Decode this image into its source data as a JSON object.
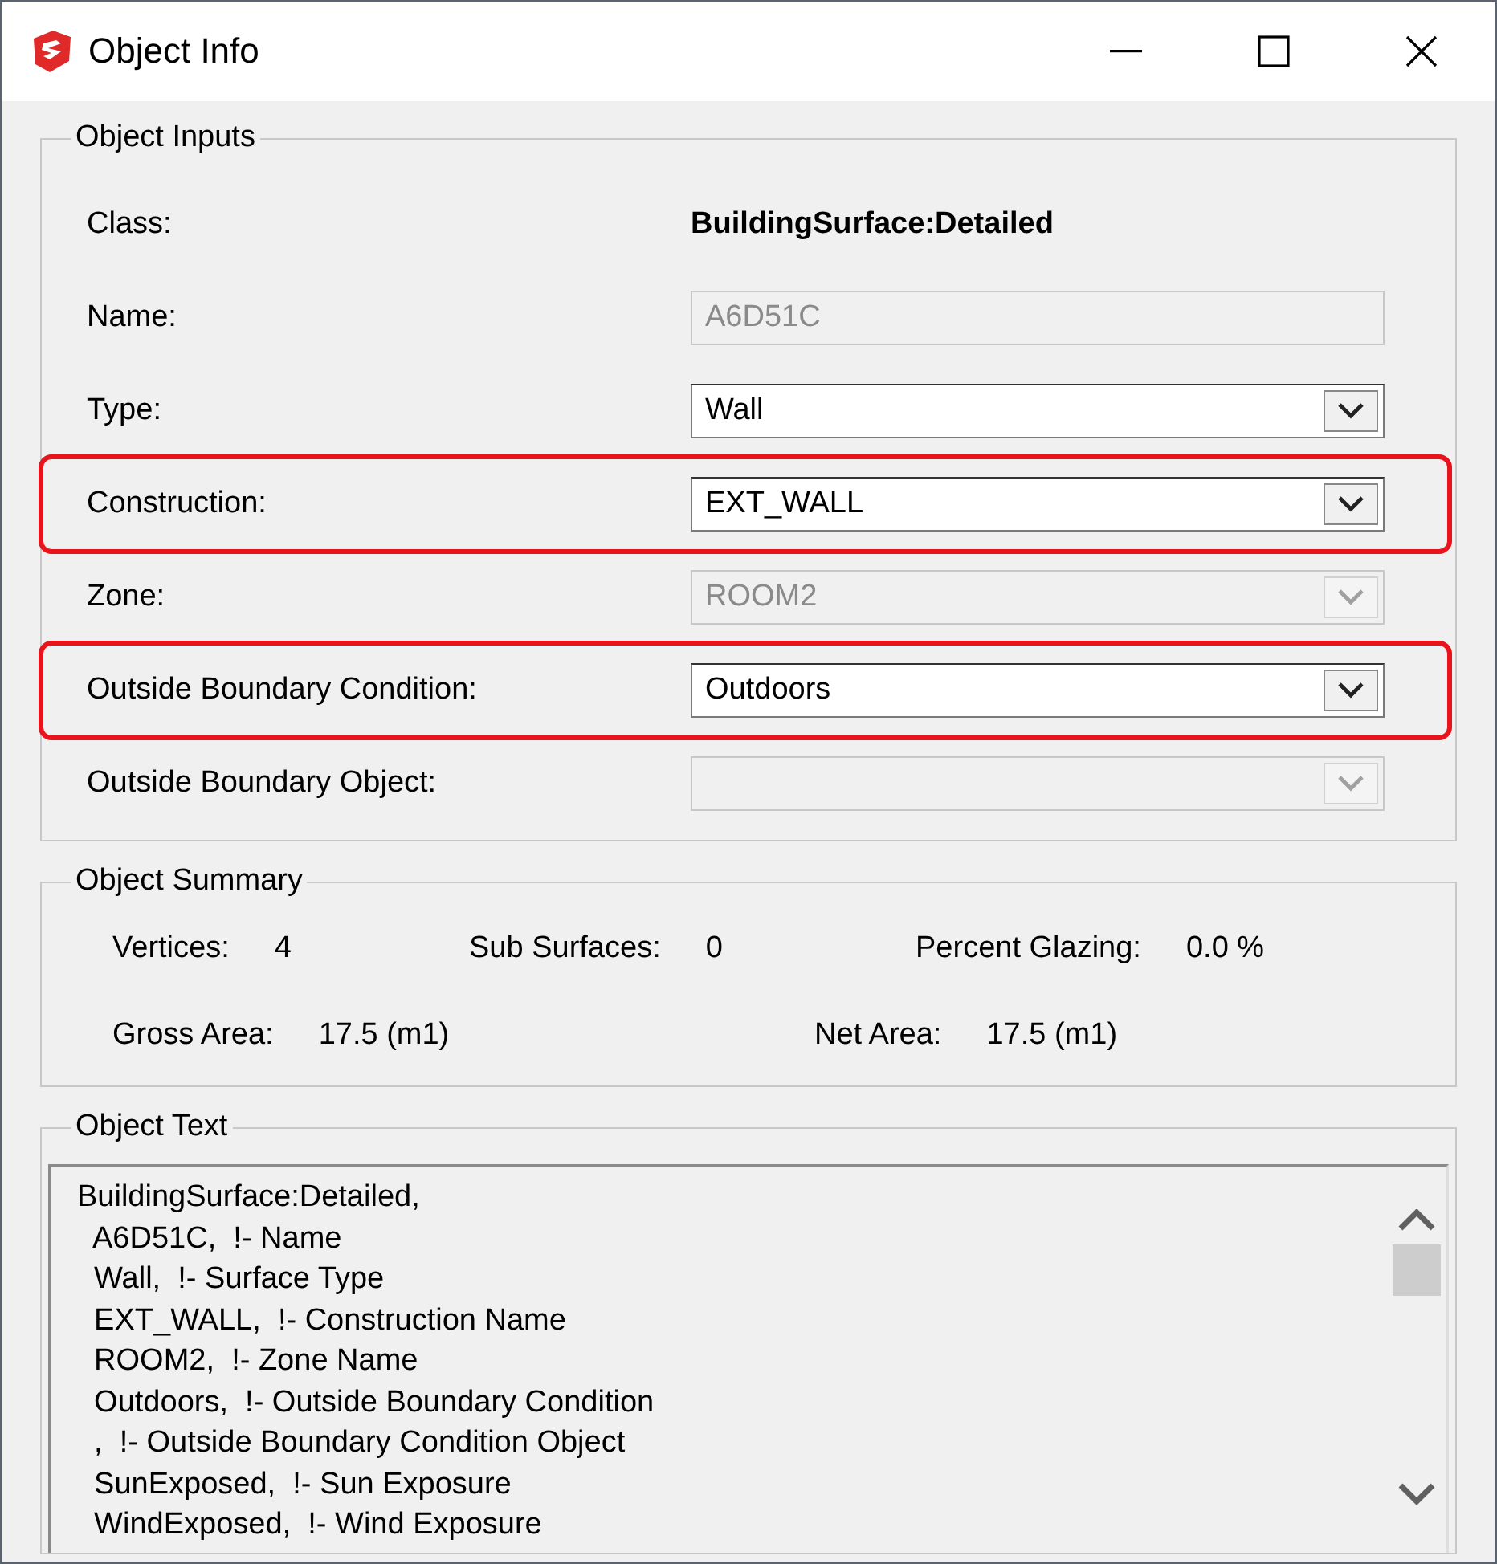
{
  "window": {
    "title": "Object Info"
  },
  "object_inputs": {
    "title": "Object Inputs",
    "fields": [
      {
        "label": "Class:",
        "kind": "static",
        "value": "BuildingSurface:Detailed",
        "highlighted": false
      },
      {
        "label": "Name:",
        "kind": "text",
        "value": "A6D51C",
        "disabled": true,
        "highlighted": false
      },
      {
        "label": "Type:",
        "kind": "dropdown",
        "value": "Wall",
        "disabled": false,
        "highlighted": false
      },
      {
        "label": "Construction:",
        "kind": "dropdown",
        "value": "EXT_WALL",
        "disabled": false,
        "highlighted": true
      },
      {
        "label": "Zone:",
        "kind": "dropdown",
        "value": "ROOM2",
        "disabled": true,
        "highlighted": false
      },
      {
        "label": "Outside Boundary Condition:",
        "kind": "dropdown",
        "value": "Outdoors",
        "disabled": false,
        "highlighted": true
      },
      {
        "label": "Outside Boundary Object:",
        "kind": "dropdown",
        "disabled": true,
        "highlighted": false
      }
    ]
  },
  "object_summary": {
    "title": "Object Summary",
    "items": [
      {
        "label": "Vertices:",
        "value": "4"
      },
      {
        "label": "Sub Surfaces:",
        "value": "0"
      },
      {
        "label": "Percent Glazing:",
        "value": "0.0 %"
      },
      {
        "label": "Gross Area:",
        "value": "17.5 (m1)"
      },
      {
        "label": "Net Area:",
        "value": "17.5 (m1)"
      }
    ]
  },
  "object_text": {
    "title": "Object Text",
    "lines": [
      "BuildingSurface:Detailed,",
      "  A6D51C,  !- Name",
      "  Wall,  !- Surface Type",
      "  EXT_WALL,  !- Construction Name",
      "  ROOM2,  !- Zone Name",
      "  Outdoors,  !- Outside Boundary Condition",
      "  ,  !- Outside Boundary Condition Object",
      "  SunExposed,  !- Sun Exposure",
      "  WindExposed,  !- Wind Exposure"
    ]
  }
}
